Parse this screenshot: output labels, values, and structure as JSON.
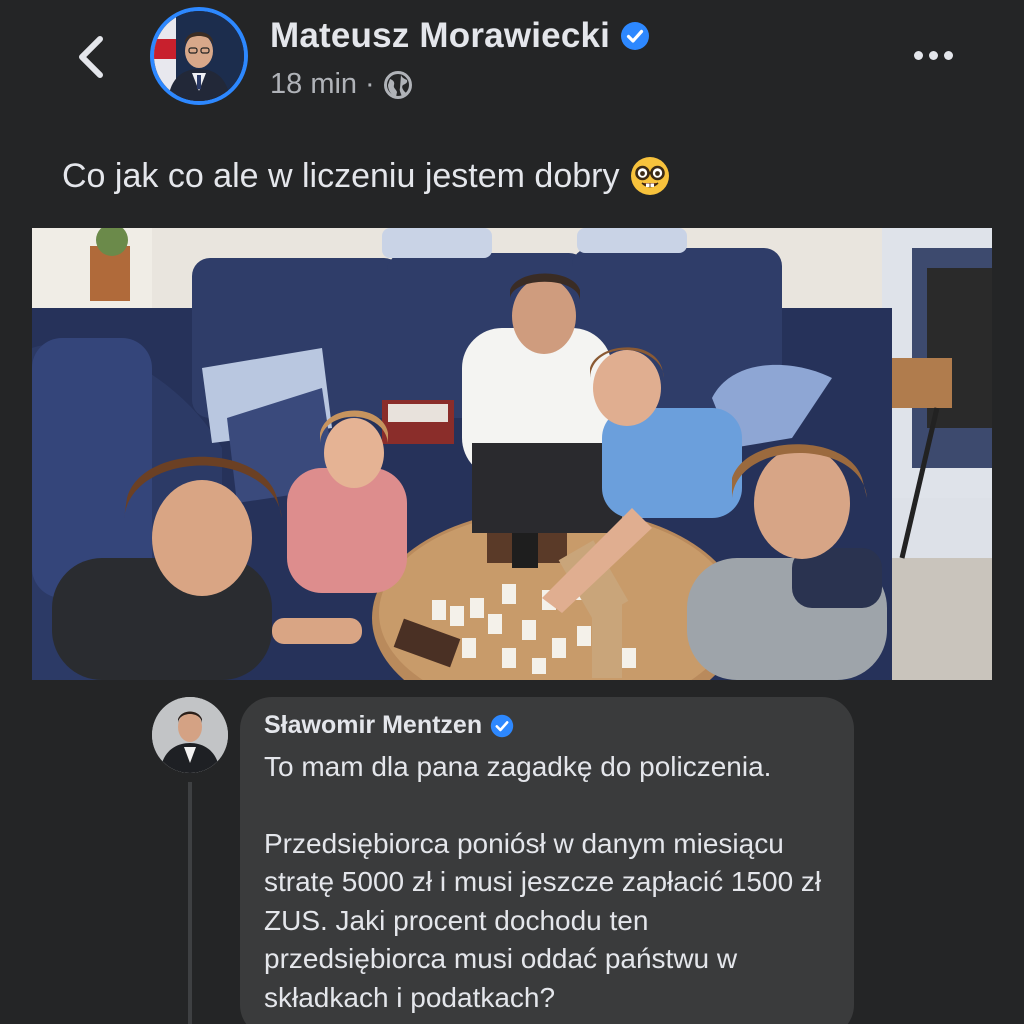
{
  "post": {
    "author": "Mateusz Morawiecki",
    "verified_icon": "verified-badge-icon",
    "time": "18 min",
    "separator": "·",
    "audience_icon": "globe-icon",
    "text": "Co jak co ale w liczeniu jestem dobry",
    "emoji": "🤓"
  },
  "header": {
    "back_icon": "back-chevron-icon",
    "more_icon": "more-dots-icon"
  },
  "comment": {
    "author": "Sławomir Mentzen",
    "paragraphs": [
      "To mam dla pana zagadkę do policzenia.",
      "Przedsiębiorca poniósł w danym miesiącu stratę 5000 zł i musi jeszcze zapłacić 1500 zł ZUS. Jaki procent dochodu ten przedsiębiorca musi oddać państwu w składkach i podatkach?"
    ]
  },
  "colors": {
    "background": "#242526",
    "bubble": "#3a3b3c",
    "accent": "#2d88ff",
    "text_primary": "#e4e6eb",
    "text_secondary": "#b0b3b8"
  }
}
